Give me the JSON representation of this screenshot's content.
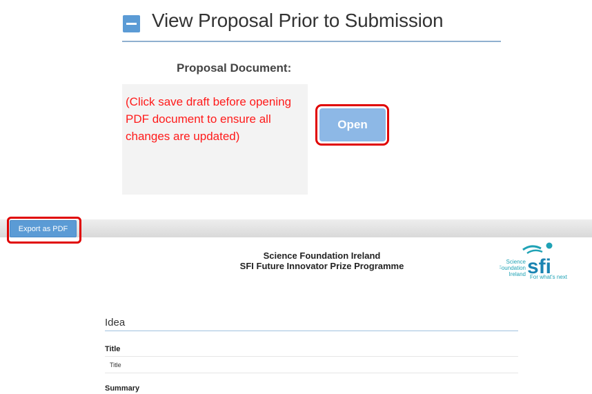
{
  "top_section": {
    "heading": "View Proposal Prior to Submission",
    "proposal_label": "Proposal Document:",
    "note": "(Click save draft before opening PDF document to ensure all changes are updated)",
    "open_button": "Open"
  },
  "pdf_viewer": {
    "export_button": "Export as PDF",
    "org_name": "Science Foundation Ireland",
    "programme_name": "SFI Future Innovator Prize Programme",
    "logo": {
      "line1": "Science",
      "line2": "Foundation",
      "line3": "Ireland",
      "mark": "sfi",
      "tagline": "For what's next"
    },
    "section_title": "Idea",
    "fields": {
      "title_label": "Title",
      "title_value": "Title",
      "summary_label": "Summary"
    }
  },
  "colors": {
    "accent_blue": "#5b9bd5",
    "open_button": "#8db8e6",
    "warning_red": "#ff1a1a",
    "highlight_red": "#e00000",
    "logo_teal": "#1fa2b5"
  }
}
